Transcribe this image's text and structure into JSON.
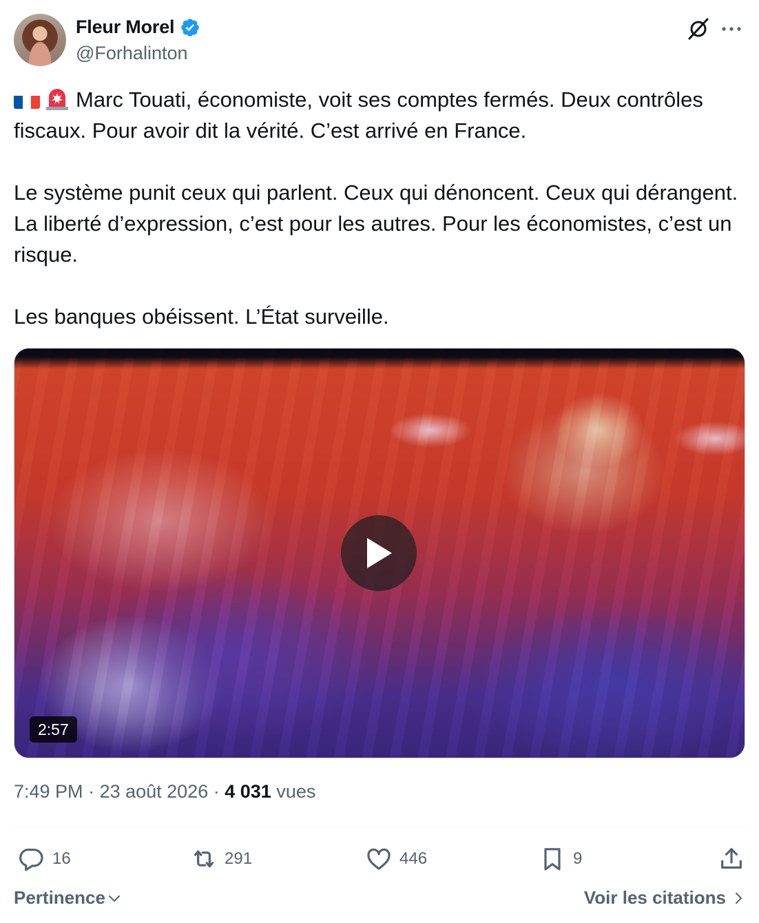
{
  "author": {
    "display_name": "Fleur Morel",
    "handle": "@Forhalinton",
    "verified": true,
    "verified_color": "#1d9bf0"
  },
  "header_icons": [
    "grok-icon",
    "more-icon"
  ],
  "tweet": {
    "emoji_prefix": [
      "flag-france-icon",
      "siren-icon"
    ],
    "line1": "Marc Touati, économiste, voit ses comptes fermés. Deux contrôles fiscaux. Pour avoir dit la vérité. C’est arrivé en France.",
    "paragraph2": "Le système punit ceux qui parlent. Ceux qui dénoncent. Ceux qui dérangent. La liberté d’expression, c’est pour les autres. Pour les économistes, c’est un risque.",
    "paragraph3": "Les banques obéissent. L’État surveille."
  },
  "media": {
    "type": "video",
    "duration": "2:57"
  },
  "meta": {
    "time": "7:49 PM",
    "separator": " · ",
    "date": "23 août 2026",
    "views_count": "4 031",
    "views_label": "vues"
  },
  "actions": {
    "replies": "16",
    "reposts": "291",
    "likes": "446",
    "bookmarks": "9"
  },
  "footer": {
    "sort_label": "Pertinence",
    "quotes_label": "Voir les citations"
  },
  "colors": {
    "text": "#0f1419",
    "secondary": "#536471",
    "accent": "#1d9bf0"
  }
}
